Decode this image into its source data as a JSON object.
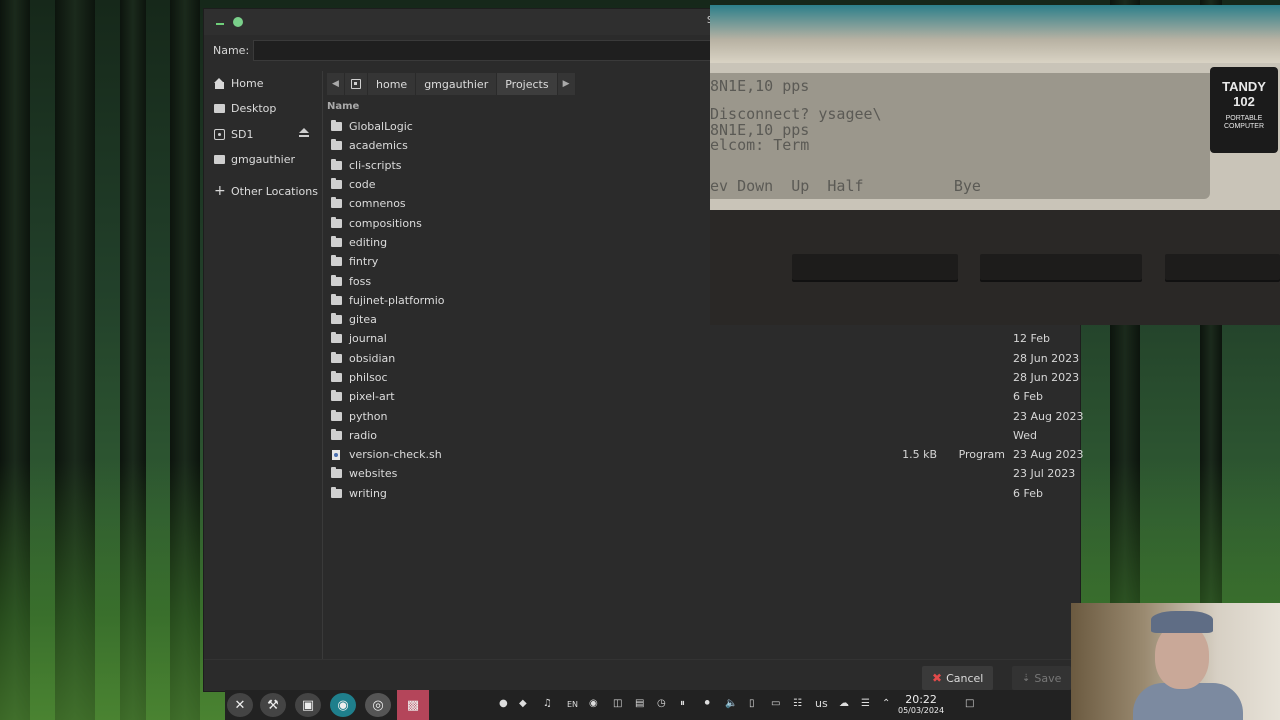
{
  "window": {
    "title": "Save RAW File"
  },
  "name_field": {
    "label": "Name:",
    "value": ""
  },
  "sidebar": {
    "items": [
      {
        "label": "Home",
        "icon": "home-icon"
      },
      {
        "label": "Desktop",
        "icon": "desktop-icon"
      },
      {
        "label": "SD1",
        "icon": "drive-icon"
      },
      {
        "label": "gmgauthier",
        "icon": "folder-icon"
      },
      {
        "label": "Other Locations",
        "icon": "plus-icon"
      }
    ]
  },
  "pathbar": {
    "segments": [
      "home",
      "gmgauthier",
      "Projects"
    ]
  },
  "list": {
    "header": "Name",
    "files": [
      {
        "name": "GlobalLogic",
        "size": "",
        "type": "",
        "date": ""
      },
      {
        "name": "academics",
        "size": "",
        "type": "",
        "date": ""
      },
      {
        "name": "cli-scripts",
        "size": "",
        "type": "",
        "date": ""
      },
      {
        "name": "code",
        "size": "",
        "type": "",
        "date": ""
      },
      {
        "name": "comnenos",
        "size": "",
        "type": "",
        "date": ""
      },
      {
        "name": "compositions",
        "size": "",
        "type": "",
        "date": ""
      },
      {
        "name": "editing",
        "size": "",
        "type": "",
        "date": ""
      },
      {
        "name": "fintry",
        "size": "",
        "type": "",
        "date": ""
      },
      {
        "name": "foss",
        "size": "",
        "type": "",
        "date": ""
      },
      {
        "name": "fujinet-platformio",
        "size": "",
        "type": "",
        "date": ""
      },
      {
        "name": "gitea",
        "size": "",
        "type": "",
        "date": ""
      },
      {
        "name": "journal",
        "size": "",
        "type": "",
        "date": "12 Feb"
      },
      {
        "name": "obsidian",
        "size": "",
        "type": "",
        "date": "28 Jun 2023"
      },
      {
        "name": "philsoc",
        "size": "",
        "type": "",
        "date": "28 Jun 2023"
      },
      {
        "name": "pixel-art",
        "size": "",
        "type": "",
        "date": "6 Feb"
      },
      {
        "name": "python",
        "size": "",
        "type": "",
        "date": "23 Aug 2023"
      },
      {
        "name": "radio",
        "size": "",
        "type": "",
        "date": "Wed"
      },
      {
        "name": "version-check.sh",
        "size": "1.5 kB",
        "type": "Program",
        "date": "23 Aug 2023"
      },
      {
        "name": "websites",
        "size": "",
        "type": "",
        "date": "23 Jul 2023"
      },
      {
        "name": "writing",
        "size": "",
        "type": "",
        "date": "6 Feb"
      }
    ]
  },
  "buttons": {
    "cancel": "Cancel",
    "save": "Save"
  },
  "overlay": {
    "lcd_lines": [
      "8N1E,10 pps",
      "Disconnect? ysagee\\",
      "8N1E,10 pps",
      "elcom: Term",
      "",
      "ev Down  Up  Half          Bye"
    ],
    "brand_line1": "TANDY",
    "brand_line2": "102",
    "brand_sub1": "PORTABLE",
    "brand_sub2": "COMPUTER"
  },
  "taskbar": {
    "tray": [
      "EN",
      "us"
    ],
    "clock_time": "20:22",
    "clock_date": "05/03/2024"
  }
}
